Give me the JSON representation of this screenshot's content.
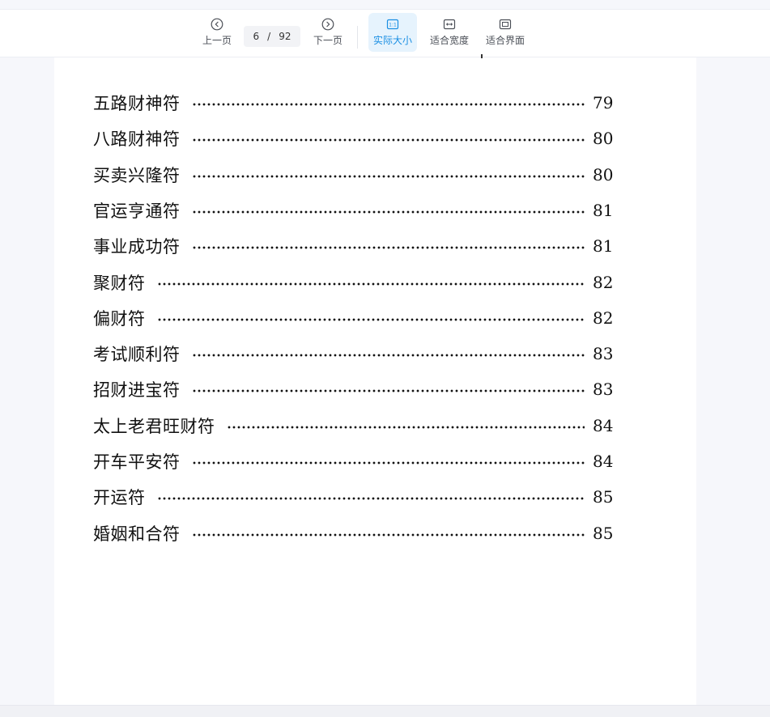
{
  "toolbar": {
    "prev_label": "上一页",
    "next_label": "下一页",
    "current_page": "6",
    "separator": "/",
    "total_pages": "92",
    "actual_size_label": "实际大小",
    "fit_width_label": "适合宽度",
    "fit_page_label": "适合界面",
    "accent_color": "#1a8fe3"
  },
  "toc": {
    "entries": [
      {
        "title": "五路财神符",
        "page": "79"
      },
      {
        "title": "八路财神符",
        "page": "80"
      },
      {
        "title": "买卖兴隆符",
        "page": "80"
      },
      {
        "title": "官运亨通符",
        "page": "81"
      },
      {
        "title": "事业成功符",
        "page": "81"
      },
      {
        "title": "聚财符",
        "page": "82"
      },
      {
        "title": "偏财符",
        "page": "82"
      },
      {
        "title": "考试顺利符",
        "page": "83"
      },
      {
        "title": "招财进宝符",
        "page": "83"
      },
      {
        "title": "太上老君旺财符",
        "page": "84"
      },
      {
        "title": "开车平安符",
        "page": "84"
      },
      {
        "title": "开运符",
        "page": "85"
      },
      {
        "title": "婚姻和合符",
        "page": "85"
      }
    ]
  }
}
